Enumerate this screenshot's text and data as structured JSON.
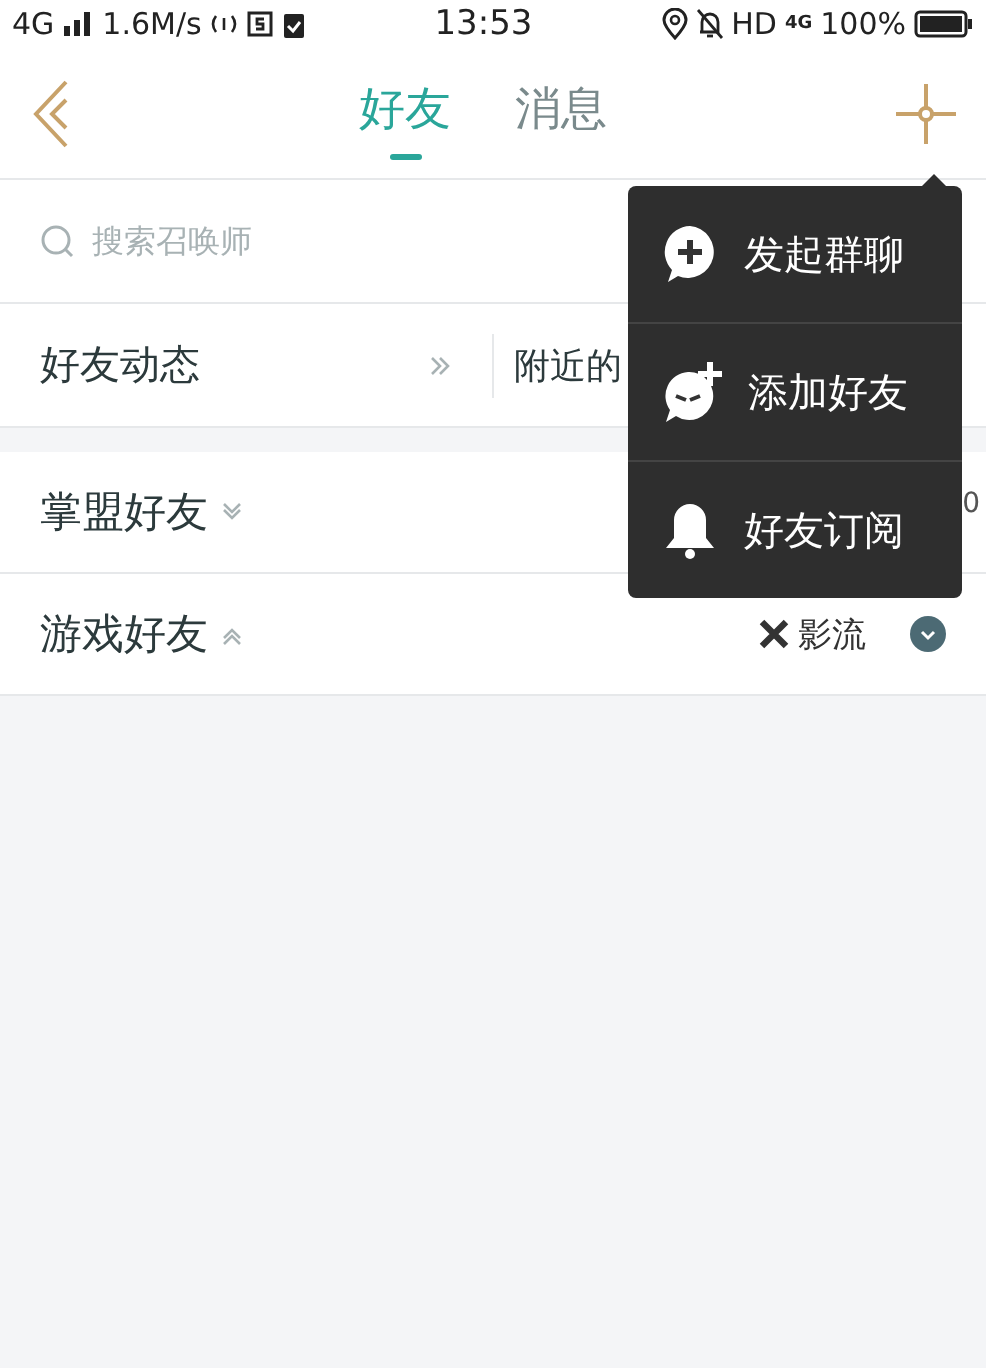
{
  "status_bar": {
    "network": "4G",
    "speed": "1.6M/s",
    "time": "13:53",
    "hd": "HD",
    "network_small": "4G",
    "battery": "100%"
  },
  "header": {
    "tabs": [
      {
        "label": "好友",
        "selected": true
      },
      {
        "label": "消息",
        "selected": false
      }
    ]
  },
  "search": {
    "placeholder": "搜索召唤师"
  },
  "links": [
    {
      "label": "好友动态"
    },
    {
      "label": "附近的"
    }
  ],
  "groups": [
    {
      "title": "掌盟好友",
      "expanded": false,
      "count": "0"
    },
    {
      "title": "游戏好友",
      "expanded": true,
      "server": "影流"
    }
  ],
  "menu": {
    "items": [
      {
        "kind": "group-chat",
        "label": "发起群聊"
      },
      {
        "kind": "add-friend",
        "label": "添加好友"
      },
      {
        "kind": "subscribe",
        "label": "好友订阅"
      }
    ]
  }
}
